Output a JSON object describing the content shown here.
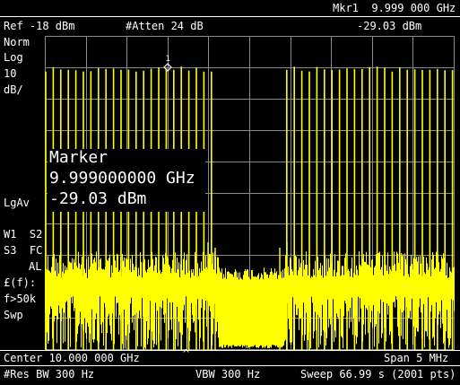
{
  "header": {
    "ref_level": "Ref -18 dBm",
    "attenuation": "#Atten 24 dB",
    "marker_label": "Mkr1  9.999 000 GHz",
    "marker_amplitude": "-29.03 dBm"
  },
  "left_panel": {
    "mode": "Norm",
    "scale_type": "Log",
    "scale_value": "10",
    "scale_unit": "dB/",
    "avg_type": "LgAv",
    "trace_row1": "W1  S2",
    "trace_row2": "S3  FC",
    "trace_row3": "AL",
    "ff_label": "£(f):",
    "ff_value": "f>50k",
    "sweep_mode": "Swp"
  },
  "marker_readout": {
    "title": "Marker",
    "frequency": "9.999000000 GHz",
    "amplitude": "-29.03 dBm",
    "marker_number": "1"
  },
  "footer": {
    "center": "Center 10.000 000 GHz",
    "span": "Span 5 MHz",
    "res_bw": "#Res BW 300 Hz",
    "vbw": "VBW 300 Hz",
    "sweep": "Sweep 66.99 s (2001 pts)",
    "center_caret": "^"
  },
  "colors": {
    "trace": "#ffff00",
    "background": "#000000",
    "text": "#ffffff",
    "grid": "#8a8a8a"
  }
}
